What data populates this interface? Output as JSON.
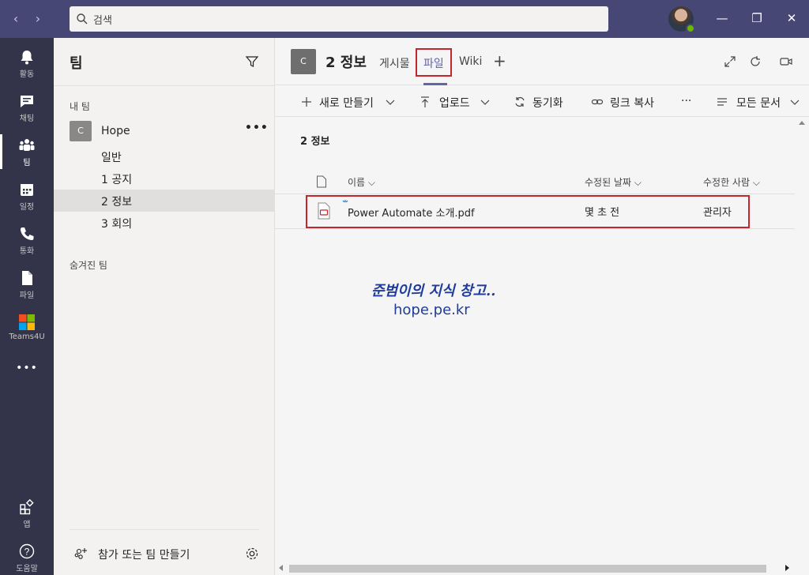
{
  "titlebar": {
    "back": "‹",
    "forward": "›",
    "search_placeholder": "검색",
    "minimize": "—",
    "restore": "❐",
    "close": "✕"
  },
  "rail": {
    "items": [
      {
        "label": "활동",
        "icon": "bell-icon"
      },
      {
        "label": "채팅",
        "icon": "chat-icon"
      },
      {
        "label": "팀",
        "icon": "teams-icon"
      },
      {
        "label": "일정",
        "icon": "calendar-icon"
      },
      {
        "label": "통화",
        "icon": "phone-icon"
      },
      {
        "label": "파일",
        "icon": "file-icon"
      },
      {
        "label": "Teams4U",
        "icon": "teams4u-icon"
      },
      {
        "label": "앱",
        "icon": "apps-icon"
      },
      {
        "label": "도움말",
        "icon": "help-icon"
      }
    ],
    "more": "•••"
  },
  "panel": {
    "title": "팀",
    "my_teams_label": "내 팀",
    "team": {
      "avatar": "C",
      "name": "Hope",
      "more": "•••"
    },
    "channels": [
      "일반",
      "1 공지",
      "2 정보",
      "3 회의"
    ],
    "hidden_label": "숨겨진 팀",
    "join_label": "참가 또는 팀 만들기"
  },
  "main": {
    "channel_avatar": "C",
    "channel_title": "2 정보",
    "tabs": {
      "posts": "게시물",
      "files": "파일",
      "wiki": "Wiki",
      "add": "+"
    },
    "toolbar": {
      "new": "새로 만들기",
      "upload": "업로드",
      "sync": "동기화",
      "copy_link": "링크 복사",
      "more": "···",
      "all_docs": "모든 문서"
    },
    "folder_title": "2 정보",
    "columns": {
      "name": "이름",
      "modified": "수정된 날짜",
      "modified_by": "수정한 사람"
    },
    "files": [
      {
        "name": "Power Automate 소개.pdf",
        "modified": "몇 초 전",
        "modified_by": "관리자"
      }
    ],
    "watermark_line1": "준범이의 지식 창고..",
    "watermark_line2": "hope.pe.kr"
  }
}
